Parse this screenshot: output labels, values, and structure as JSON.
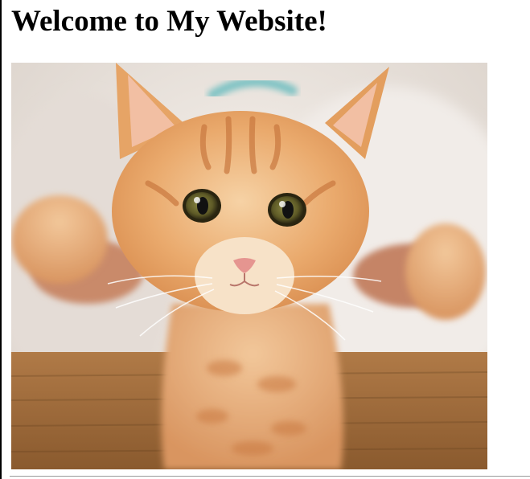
{
  "page": {
    "title": "Welcome to My Website!"
  },
  "image": {
    "subject": "kitten-photo",
    "colors": {
      "background": "#e9e2dc",
      "fur": "#e8a56a",
      "fur_light": "#f3c996",
      "stripes": "#c9783f",
      "table": "#a8723f",
      "skin": "#c98a6a",
      "eyes": "#5a5a2a"
    }
  }
}
